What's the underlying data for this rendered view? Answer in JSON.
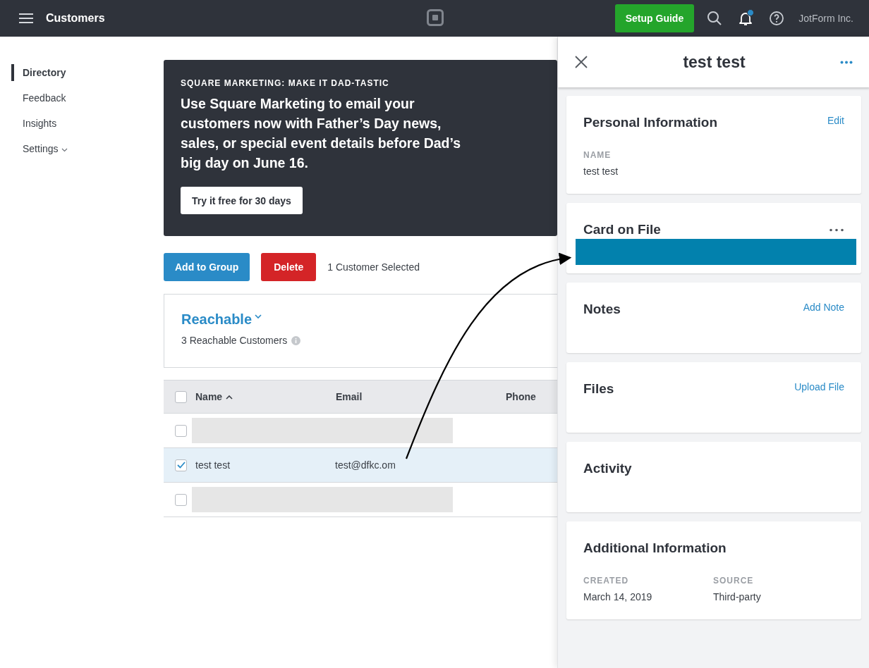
{
  "topbar": {
    "title": "Customers",
    "setup_button": "Setup Guide",
    "has_notification": true,
    "account": "JotForm Inc."
  },
  "sidebar": {
    "items": [
      {
        "label": "Directory",
        "selected": true,
        "kind": "link"
      },
      {
        "label": "Feedback",
        "selected": false,
        "kind": "link"
      },
      {
        "label": "Insights",
        "selected": false,
        "kind": "link"
      },
      {
        "label": "Settings",
        "selected": false,
        "kind": "dropdown"
      }
    ]
  },
  "banner": {
    "eyebrow": "SQUARE MARKETING: MAKE IT DAD-TASTIC",
    "text": "Use Square Marketing to email your customers now with Father’s Day news, sales, or special event details before Dad’s big day on June 16.",
    "button": "Try it free for 30 days"
  },
  "actions": {
    "buttons": [
      {
        "label": "Add to Group",
        "kind": "primary"
      },
      {
        "label": "Delete",
        "kind": "danger"
      }
    ],
    "selection_text": "1 Customer Selected"
  },
  "segment": {
    "title": "Reachable",
    "subtitle": "3 Reachable Customers"
  },
  "table": {
    "all_checked": false,
    "columns": [
      {
        "label": "Name",
        "sorted": true
      },
      {
        "label": "Email",
        "sorted": false
      },
      {
        "label": "Phone",
        "sorted": false
      }
    ],
    "rows": [
      {
        "kind": "redacted",
        "selected": false,
        "checked": false
      },
      {
        "kind": "data",
        "selected": true,
        "checked": true,
        "name": "test test",
        "email": "test@dfkc.om"
      },
      {
        "kind": "redacted",
        "selected": false,
        "checked": false
      }
    ]
  },
  "panel": {
    "title": "test test",
    "sections": [
      {
        "kind": "info",
        "title": "Personal Information",
        "action": "Edit",
        "fields": [
          {
            "label": "NAME",
            "value": "test test"
          }
        ]
      },
      {
        "kind": "card",
        "title": "Card on File"
      },
      {
        "kind": "empty",
        "title": "Notes",
        "action": "Add Note"
      },
      {
        "kind": "empty",
        "title": "Files",
        "action": "Upload File"
      },
      {
        "kind": "empty",
        "title": "Activity"
      },
      {
        "kind": "info",
        "title": "Additional Information",
        "fields": [
          {
            "label": "CREATED",
            "value": "March 14, 2019"
          },
          {
            "label": "SOURCE",
            "value": "Third-party"
          }
        ]
      }
    ]
  }
}
